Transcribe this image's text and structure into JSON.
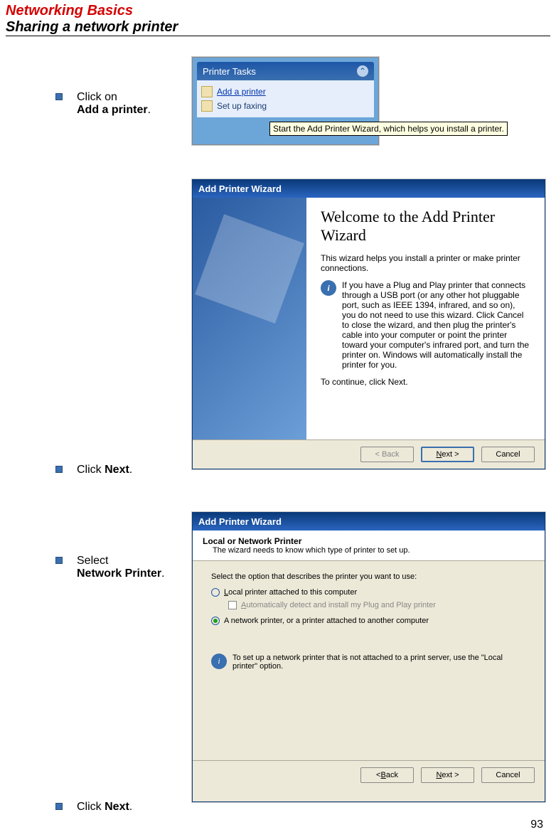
{
  "header": {
    "title_red": "Networking Basics",
    "title_black": "Sharing a network printer"
  },
  "instructions": {
    "step1_a": "Click on",
    "step1_b": "Add a printer",
    "step2_a": "Click ",
    "step2_b": "Next",
    "step3_a": "Select",
    "step3_b": "Network Printer",
    "step4_a": "Click ",
    "step4_b": "Next"
  },
  "shot1": {
    "panel_title": "Printer Tasks",
    "task_add": "Add a printer",
    "task_fax": "Set up faxing",
    "tooltip": "Start the Add Printer Wizard, which helps you install a printer."
  },
  "shot2": {
    "titlebar": "Add Printer Wizard",
    "heading": "Welcome to the Add Printer Wizard",
    "para1": "This wizard helps you install a printer or make printer connections.",
    "info": "If you have a Plug and Play printer that connects through a USB port (or any other hot pluggable port, such as IEEE 1394, infrared, and so on), you do not need to use this wizard. Click Cancel to close the wizard, and then plug the printer's cable into your computer or point the printer toward your computer's infrared port, and turn the printer on. Windows will automatically install the printer for you.",
    "para2": "To continue, click Next.",
    "btn_back": "< Back",
    "btn_next_pre": "N",
    "btn_next_post": "ext >",
    "btn_cancel": "Cancel"
  },
  "shot3": {
    "titlebar": "Add Printer Wizard",
    "sub_title": "Local or Network Printer",
    "sub_desc": "The wizard needs to know which type of printer to set up.",
    "prompt": "Select the option that describes the printer you want to use:",
    "radio1_pre": "L",
    "radio1_post": "ocal printer attached to this computer",
    "check_pre": "A",
    "check_post": "utomatically detect and install my Plug and Play printer",
    "radio2": "A network printer, or a printer attached to another computer",
    "note": "To set up a network printer that is not attached to a print server, use the \"Local printer\" option.",
    "btn_back_pre": "< ",
    "btn_back_u": "B",
    "btn_back_post": "ack",
    "btn_next_pre": "N",
    "btn_next_post": "ext >",
    "btn_cancel": "Cancel"
  },
  "page_number": "93"
}
